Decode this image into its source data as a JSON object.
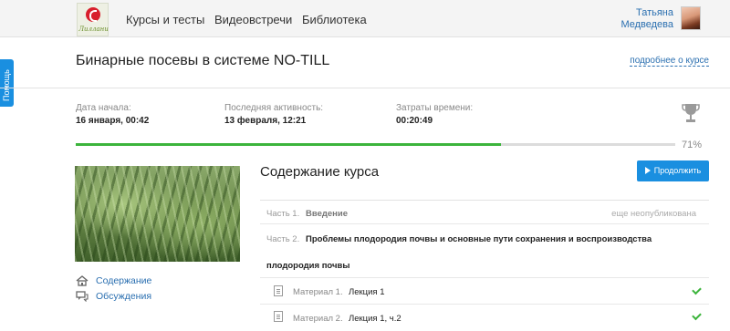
{
  "header": {
    "logo_text": "Лиллани",
    "nav": [
      "Курсы и тесты",
      "Видеовстречи",
      "Библиотека"
    ],
    "user": {
      "first_name": "Татьяна",
      "last_name": "Медведева"
    }
  },
  "help_tab": "Помощь",
  "course": {
    "title": "Бинарные посевы в системе NO-TILL",
    "about_link": "подробнее о курсе"
  },
  "stats": {
    "start": {
      "label": "Дата начала:",
      "value": "16 января, 00:42"
    },
    "last_activity": {
      "label": "Последняя активность:",
      "value": "13 февраля, 12:21"
    },
    "time_spent": {
      "label": "Затраты времени:",
      "value": "00:20:49"
    }
  },
  "progress": {
    "percent_text": "71%",
    "fraction": 0.71
  },
  "sidebar": {
    "contents_link": "Содержание",
    "discussions_link": "Обсуждения"
  },
  "contents": {
    "title": "Содержание курса",
    "continue_button": "Продолжить",
    "parts": [
      {
        "label": "Часть 1.",
        "title": "Введение",
        "status": "еще неопубликована"
      },
      {
        "label": "Часть 2.",
        "title_line1": "Проблемы плодородия почвы и основные пути сохранения и воспроизводства",
        "title_line2": "плодородия почвы"
      }
    ],
    "materials": [
      {
        "label": "Материал 1.",
        "title": "Лекция 1",
        "done": true
      },
      {
        "label": "Материал 2.",
        "title": "Лекция 1, ч.2",
        "done": true
      }
    ]
  },
  "colors": {
    "accent": "#1a8fe0",
    "progress": "#3cb43c",
    "link": "#2a6fb0"
  }
}
